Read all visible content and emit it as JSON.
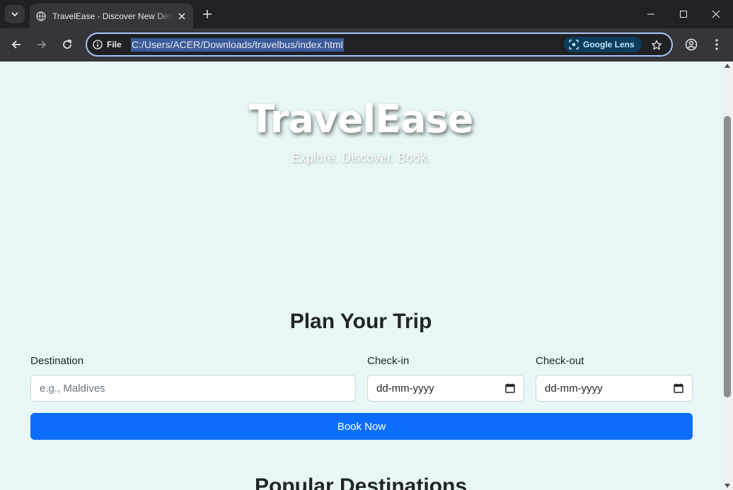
{
  "browser": {
    "tab": {
      "title": "TravelEase - Discover New Destinations"
    },
    "address_bar": {
      "scheme_label": "File",
      "url": "C:/Users/ACER/Downloads/travelbus/index.html",
      "lens_label": "Google Lens"
    }
  },
  "page": {
    "hero": {
      "title": "TravelEase",
      "subtitle": "Explore. Discover. Book."
    },
    "plan": {
      "title": "Plan Your Trip",
      "destination_label": "Destination",
      "destination_placeholder": "e.g., Maldives",
      "checkin_label": "Check-in",
      "checkin_value": "dd-mm-yyyy",
      "checkout_label": "Check-out",
      "checkout_value": "dd-mm-yyyy",
      "book_button": "Book Now"
    },
    "popular": {
      "title": "Popular Destinations"
    }
  },
  "colors": {
    "page_background": "#e8f6f7",
    "primary_button": "#0d6efd",
    "browser_frame": "#202124",
    "toolbar": "#35363a",
    "url_highlight": "#3b5a9a"
  },
  "icons": [
    "tab-search-icon",
    "globe-icon",
    "close-icon",
    "plus-icon",
    "minimize-icon",
    "maximize-icon",
    "back-arrow-icon",
    "forward-arrow-icon",
    "reload-icon",
    "info-icon",
    "lens-icon",
    "star-icon",
    "profile-icon",
    "kebab-menu-icon",
    "calendar-icon"
  ]
}
